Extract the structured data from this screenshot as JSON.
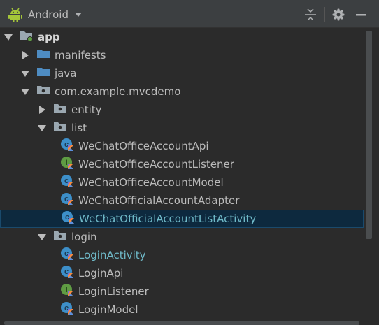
{
  "toolbar": {
    "view_label": "Android",
    "icons": [
      "android-icon",
      "collapse-all-icon",
      "settings-gear-icon",
      "hide-minus-icon"
    ]
  },
  "tree": [
    {
      "label": "app",
      "depth": 0,
      "arrow": "down",
      "icon": "module-folder",
      "style": "bold"
    },
    {
      "label": "manifests",
      "depth": 1,
      "arrow": "right",
      "icon": "blue-folder"
    },
    {
      "label": "java",
      "depth": 1,
      "arrow": "down",
      "icon": "blue-folder"
    },
    {
      "label": "com.example.mvcdemo",
      "depth": 2,
      "arrow": "down",
      "icon": "package"
    },
    {
      "label": "entity",
      "depth": 3,
      "arrow": "right",
      "icon": "package"
    },
    {
      "label": "list",
      "depth": 3,
      "arrow": "down",
      "icon": "package"
    },
    {
      "label": "WeChatOfficeAccountApi",
      "depth": 4,
      "arrow": "none",
      "icon": "kotlin-class"
    },
    {
      "label": "WeChatOfficeAccountListener",
      "depth": 4,
      "arrow": "none",
      "icon": "kotlin-interface"
    },
    {
      "label": "WeChatOfficeAccountModel",
      "depth": 4,
      "arrow": "none",
      "icon": "kotlin-class"
    },
    {
      "label": "WeChatOfficialAccountAdapter",
      "depth": 4,
      "arrow": "none",
      "icon": "kotlin-class"
    },
    {
      "label": "WeChatOfficialAccountListActivity",
      "depth": 4,
      "arrow": "none",
      "icon": "kotlin-class",
      "style": "modified",
      "selected": true
    },
    {
      "label": "login",
      "depth": 3,
      "arrow": "down",
      "icon": "package"
    },
    {
      "label": "LoginActivity",
      "depth": 4,
      "arrow": "none",
      "icon": "kotlin-class",
      "style": "modified"
    },
    {
      "label": "LoginApi",
      "depth": 4,
      "arrow": "none",
      "icon": "kotlin-class"
    },
    {
      "label": "LoginListener",
      "depth": 4,
      "arrow": "none",
      "icon": "kotlin-interface"
    },
    {
      "label": "LoginModel",
      "depth": 4,
      "arrow": "none",
      "icon": "kotlin-class"
    }
  ],
  "colors": {
    "background": "#2b2b2b",
    "toolbar": "#3c3f41",
    "text": "#bbbbbb",
    "modified_text": "#6fb9c8",
    "selection": "#0d293e",
    "class_icon": "#3d8fc9",
    "interface_icon": "#5f9c43",
    "folder": "#4e8cc2",
    "android_green": "#a4c639"
  }
}
